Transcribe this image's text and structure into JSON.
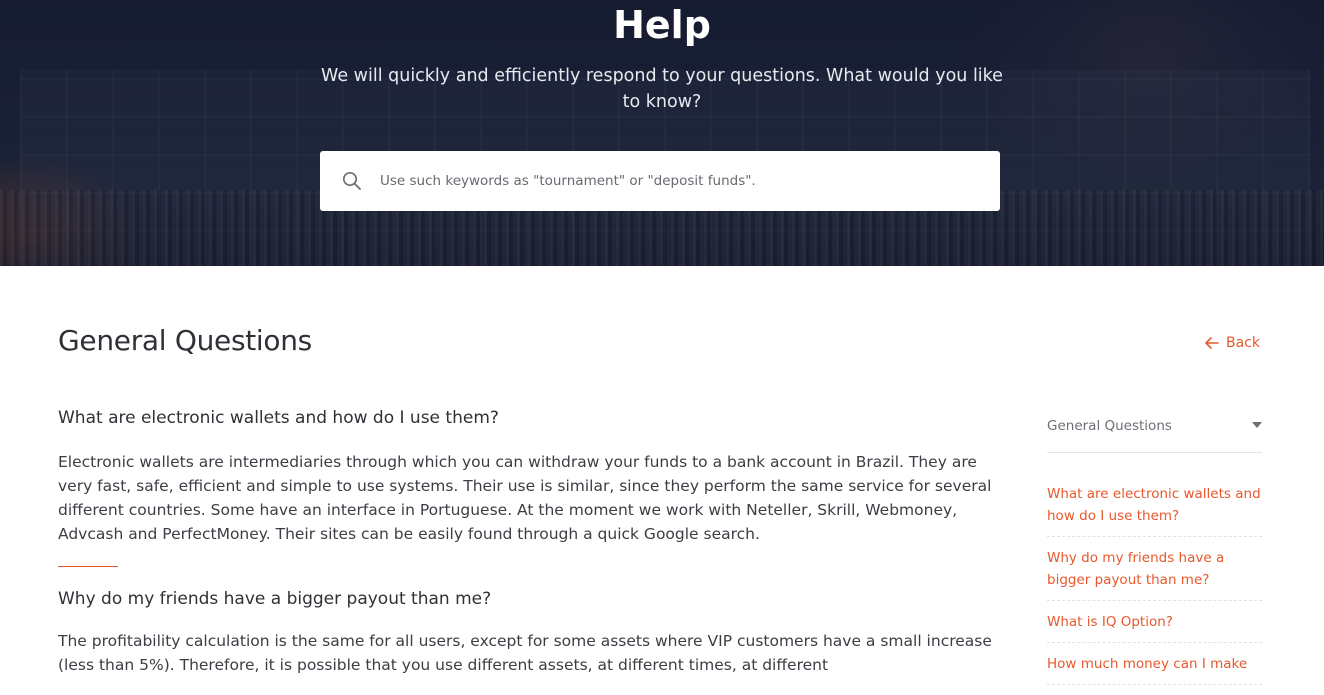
{
  "hero": {
    "title": "Help",
    "subtitle": "We will quickly and efficiently respond to your questions. What would you like to know?",
    "search": {
      "placeholder": "Use such keywords as \"tournament\" or \"deposit funds\".",
      "value": ""
    }
  },
  "main": {
    "title": "General Questions",
    "back_label": "Back",
    "questions": [
      {
        "title": "What are electronic wallets and how do I use them?",
        "body": "Electronic wallets are intermediaries through which you can withdraw your funds to a bank account in Brazil. They are very fast, safe, efficient and simple to use systems. Their use is similar, since they perform the same service for several different countries. Some have an interface in Portuguese. At the moment we work with Neteller, Skrill, Webmoney, Advcash and PerfectMoney. Their sites can be easily found through a quick Google search."
      },
      {
        "title": "Why do my friends have a bigger payout than me?",
        "body": "The profitability calculation is the same for all users, except for some assets where VIP customers have a small increase (less than 5%). Therefore, it is possible that you use different assets, at different times, at different"
      }
    ]
  },
  "sidebar": {
    "category_select": "General Questions",
    "items": [
      {
        "label": "What are electronic wallets and how do I use them?"
      },
      {
        "label": "Why do my friends have a bigger payout than me?"
      },
      {
        "label": "What is IQ Option?"
      },
      {
        "label": "How much money can I make"
      }
    ]
  },
  "colors": {
    "accent": "#e8582c",
    "hero_bg": "#1e2538",
    "text_dark": "#2f3136",
    "text_body": "#3b3e44"
  },
  "icons": {
    "search": "search-icon",
    "back": "arrow-left-icon",
    "select": "chevron-down-icon"
  }
}
